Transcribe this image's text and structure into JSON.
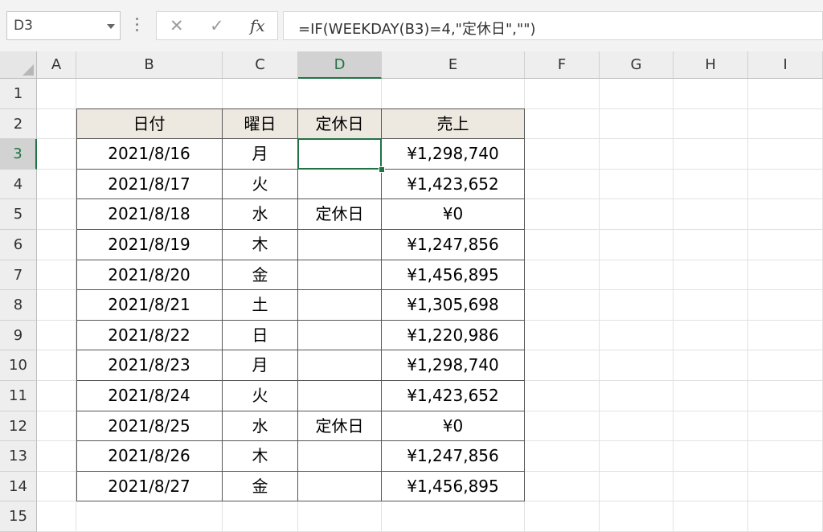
{
  "formula_bar": {
    "name_box": "D3",
    "cancel_icon": "✕",
    "enter_icon": "✓",
    "fx_label": "fx",
    "formula": "=IF(WEEKDAY(B3)=4,\"定休日\",\"\")"
  },
  "columns": [
    "A",
    "B",
    "C",
    "D",
    "E",
    "F",
    "G",
    "H",
    "I"
  ],
  "rows": [
    "1",
    "2",
    "3",
    "4",
    "5",
    "6",
    "7",
    "8",
    "9",
    "10",
    "11",
    "12",
    "13",
    "14",
    "15"
  ],
  "selected_cell": "D3",
  "table": {
    "headers": [
      "日付",
      "曜日",
      "定休日",
      "売上"
    ],
    "rows": [
      [
        "2021/8/16",
        "月",
        "",
        "¥1,298,740"
      ],
      [
        "2021/8/17",
        "火",
        "",
        "¥1,423,652"
      ],
      [
        "2021/8/18",
        "水",
        "定休日",
        "¥0"
      ],
      [
        "2021/8/19",
        "木",
        "",
        "¥1,247,856"
      ],
      [
        "2021/8/20",
        "金",
        "",
        "¥1,456,895"
      ],
      [
        "2021/8/21",
        "土",
        "",
        "¥1,305,698"
      ],
      [
        "2021/8/22",
        "日",
        "",
        "¥1,220,986"
      ],
      [
        "2021/8/23",
        "月",
        "",
        "¥1,298,740"
      ],
      [
        "2021/8/24",
        "火",
        "",
        "¥1,423,652"
      ],
      [
        "2021/8/25",
        "水",
        "定休日",
        "¥0"
      ],
      [
        "2021/8/26",
        "木",
        "",
        "¥1,247,856"
      ],
      [
        "2021/8/27",
        "金",
        "",
        "¥1,456,895"
      ]
    ]
  },
  "colors": {
    "accent": "#217346",
    "header_fill": "#ede9e0"
  }
}
